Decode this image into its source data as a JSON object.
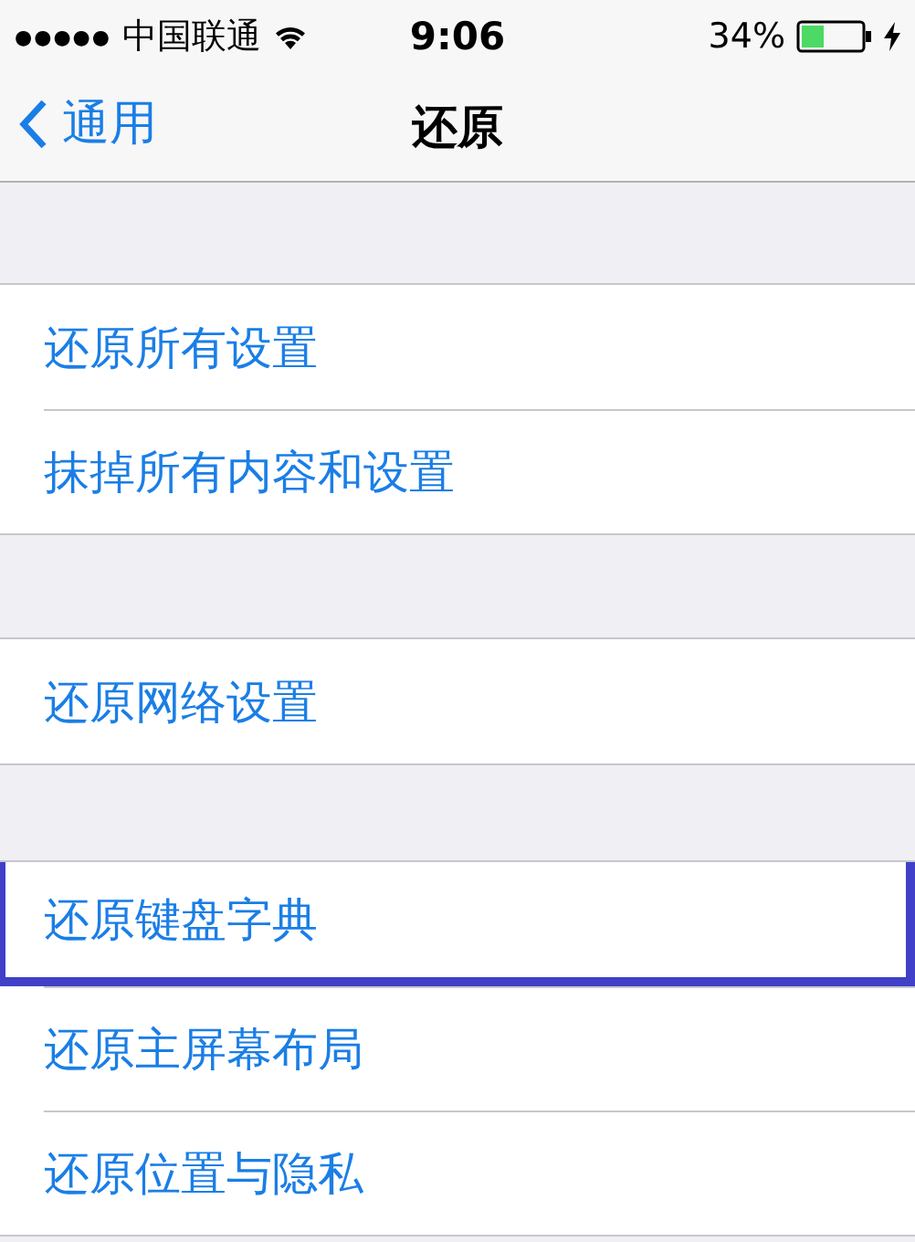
{
  "status_bar": {
    "signal": "●●●●●",
    "carrier": "中国联通",
    "time": "9:06",
    "battery": "34%"
  },
  "nav_bar": {
    "back": "通用",
    "title": "还原"
  },
  "groups": [
    {
      "items": [
        {
          "label": "还原所有设置",
          "highlighted": false
        },
        {
          "label": "抹掉所有内容和设置",
          "highlighted": false
        }
      ]
    },
    {
      "items": [
        {
          "label": "还原网络设置",
          "highlighted": false
        }
      ]
    },
    {
      "items": [
        {
          "label": "还原键盘字典",
          "highlighted": true
        },
        {
          "label": "还原主屏幕布局",
          "highlighted": false
        },
        {
          "label": "还原位置与隐私",
          "highlighted": false
        }
      ]
    }
  ]
}
